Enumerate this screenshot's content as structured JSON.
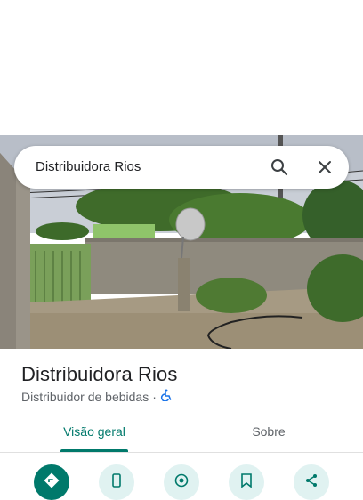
{
  "search": {
    "query": "Distribuidora Rios"
  },
  "place": {
    "name": "Distribuidora Rios",
    "category": "Distribuidor de bebidas",
    "separator": "·",
    "accessibility_icon": "wheelchair-accessible-icon"
  },
  "tabs": [
    {
      "label": "Visão geral",
      "selected": true
    },
    {
      "label": "Sobre",
      "selected": false
    }
  ],
  "actions": [
    {
      "icon": "directions-icon"
    },
    {
      "icon": "phone-icon"
    },
    {
      "icon": "nearby-icon"
    },
    {
      "icon": "save-icon"
    },
    {
      "icon": "share-icon"
    }
  ],
  "colors": {
    "accent": "#00796b",
    "accent_light": "#e0f2f1",
    "title_text": "#202124",
    "secondary_text": "#5f6368",
    "accessibility_blue": "#1a73e8"
  }
}
